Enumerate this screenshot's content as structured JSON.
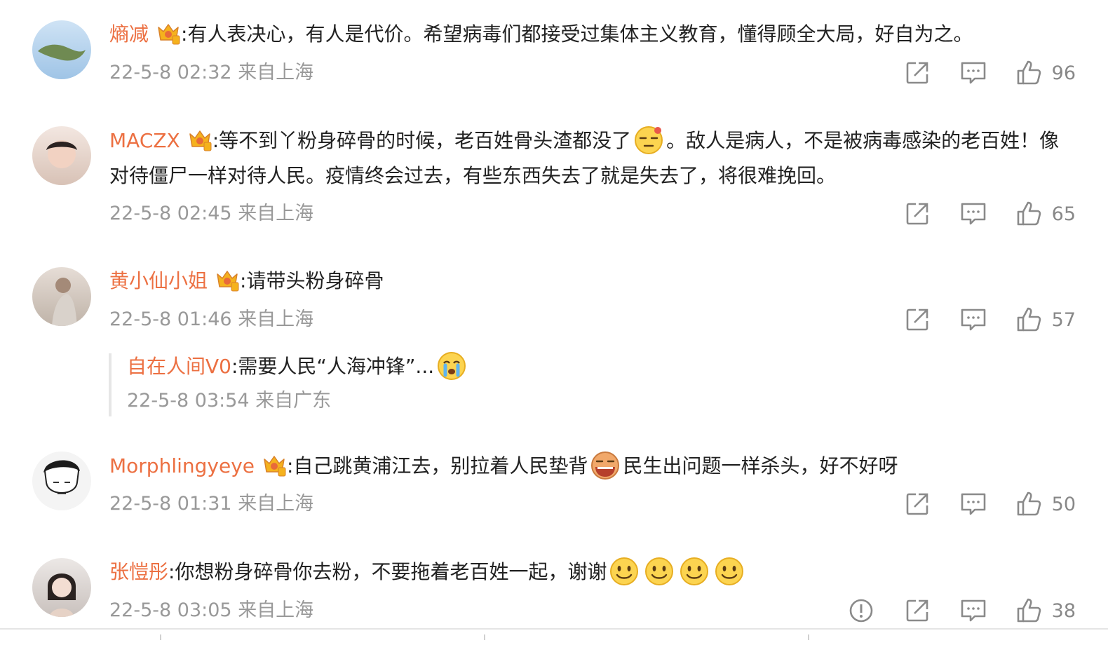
{
  "comments": [
    {
      "username": "熵减",
      "text": ":有人表决心，有人是代价。希望病毒们都接受过集体主义教育，懂得顾全大局，好自为之。",
      "time": "22-5-8 02:32",
      "source": "来自上海",
      "likes": "96"
    },
    {
      "username": "MACZX",
      "text_a": ":等不到丫粉身碎骨的时候，老百姓骨头渣都没了",
      "text_b": "。敌人是病人，不是被病毒感染的老百姓！像对待僵尸一样对待人民。疫情终会过去，有些东西失去了就是失去了，将很难挽回。",
      "time": "22-5-8 02:45",
      "source": "来自上海",
      "likes": "65"
    },
    {
      "username": "黄小仙小姐",
      "text": ":请带头粉身碎骨",
      "time": "22-5-8 01:46",
      "source": "来自上海",
      "likes": "57",
      "reply": {
        "username": "自在人间V0",
        "text": ":需要人民“人海冲锋”...",
        "time": "22-5-8 03:54",
        "source": "来自广东"
      }
    },
    {
      "username": "Morphlingyeye",
      "text_a": ":自己跳黄浦江去，别拉着人民垫背",
      "text_b": "民生出问题一样杀头，好不好呀",
      "time": "22-5-8 01:31",
      "source": "来自上海",
      "likes": "50"
    },
    {
      "username": "张愷彤",
      "text": ":你想粉身碎骨你去粉，不要拖着老百姓一起，谢谢",
      "time": "22-5-8 03:05",
      "source": "来自上海",
      "likes": "38"
    }
  ],
  "colors": {
    "username": "#ec7042",
    "text": "#222222",
    "meta": "#999999",
    "icon": "#8a8a8a"
  },
  "icons": {
    "share": "share-icon",
    "comment": "comment-icon",
    "like": "thumbs-up-icon",
    "report": "report-icon",
    "vip": "crown-badge-icon"
  }
}
